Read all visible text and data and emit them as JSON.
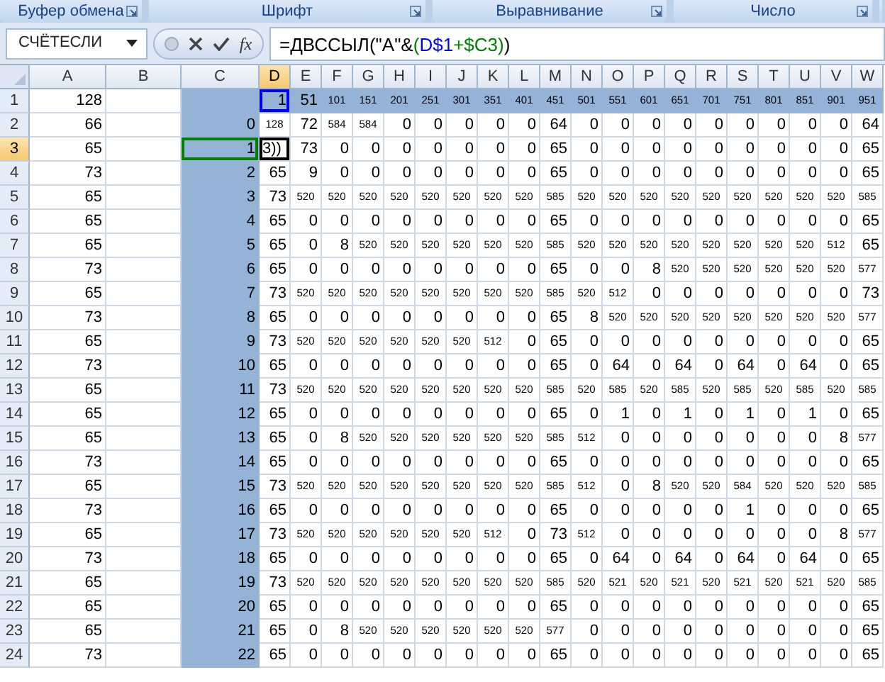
{
  "ribbon_groups": [
    {
      "label": "Буфер обмена"
    },
    {
      "label": "Шрифт"
    },
    {
      "label": "Выравнивание"
    },
    {
      "label": "Число"
    }
  ],
  "formula_bar": {
    "name_box": "СЧЁТЕСЛИ",
    "function_button": "fx",
    "formula": [
      {
        "text": "=ДВССЫЛ(\"A\"&",
        "color": "#000000"
      },
      {
        "text": "(",
        "color": "#008000"
      },
      {
        "text": "D$1",
        "color": "#0000ff"
      },
      {
        "text": "+$C3)",
        "color": "#008000"
      },
      {
        "text": ")",
        "color": "#000000"
      }
    ]
  },
  "columns": [
    {
      "label": "A",
      "selected": false,
      "shaded": false
    },
    {
      "label": "B",
      "selected": false,
      "shaded": false
    },
    {
      "label": "C",
      "selected": false,
      "shaded": true
    },
    {
      "label": "D",
      "selected": true,
      "shaded": false
    },
    {
      "label": "E",
      "selected": false,
      "shaded": false
    },
    {
      "label": "F",
      "selected": false,
      "shaded": false
    },
    {
      "label": "G",
      "selected": false,
      "shaded": false
    },
    {
      "label": "H",
      "selected": false,
      "shaded": false
    },
    {
      "label": "I",
      "selected": false,
      "shaded": false
    },
    {
      "label": "J",
      "selected": false,
      "shaded": false
    },
    {
      "label": "K",
      "selected": false,
      "shaded": false
    },
    {
      "label": "L",
      "selected": false,
      "shaded": false
    },
    {
      "label": "M",
      "selected": false,
      "shaded": false
    },
    {
      "label": "N",
      "selected": false,
      "shaded": false
    },
    {
      "label": "O",
      "selected": false,
      "shaded": false
    },
    {
      "label": "P",
      "selected": false,
      "shaded": false
    },
    {
      "label": "Q",
      "selected": false,
      "shaded": false
    },
    {
      "label": "R",
      "selected": false,
      "shaded": false
    },
    {
      "label": "S",
      "selected": false,
      "shaded": false
    },
    {
      "label": "T",
      "selected": false,
      "shaded": false
    },
    {
      "label": "U",
      "selected": false,
      "shaded": false
    },
    {
      "label": "V",
      "selected": false,
      "shaded": false
    },
    {
      "label": "W",
      "selected": false,
      "shaded": false
    }
  ],
  "rows": [
    {
      "header": "1",
      "selected": false,
      "shaded": true,
      "cells": [
        "128",
        null,
        null,
        {
          "text": "1",
          "color": "#0000ff"
        },
        "51",
        "101",
        "151",
        "201",
        "251",
        "301",
        "351",
        "401",
        "451",
        "501",
        "551",
        "601",
        "651",
        "701",
        "751",
        "801",
        "851",
        "901",
        "951"
      ]
    },
    {
      "header": "2",
      "selected": false,
      "cells": [
        "66",
        null,
        "0",
        "128",
        "72",
        "584",
        "584",
        "0",
        "0",
        "0",
        "0",
        "0",
        "64",
        "0",
        "0",
        "0",
        "0",
        "0",
        "0",
        "0",
        "0",
        "0",
        "64"
      ]
    },
    {
      "header": "3",
      "selected": true,
      "cells": [
        "65",
        null,
        {
          "text": "1",
          "color": "#008000"
        },
        {
          "text": "3))",
          "editing": true
        },
        "73",
        "0",
        "0",
        "0",
        "0",
        "0",
        "0",
        "0",
        "65",
        "0",
        "0",
        "0",
        "0",
        "0",
        "0",
        "0",
        "0",
        "0",
        "65"
      ]
    },
    {
      "header": "4",
      "selected": false,
      "cells": [
        "73",
        null,
        "2",
        "65",
        "9",
        "0",
        "0",
        "0",
        "0",
        "0",
        "0",
        "0",
        "65",
        "0",
        "0",
        "0",
        "0",
        "0",
        "0",
        "0",
        "0",
        "0",
        "65"
      ]
    },
    {
      "header": "5",
      "selected": false,
      "cells": [
        "65",
        null,
        "3",
        "73",
        "520",
        "520",
        "520",
        "520",
        "520",
        "520",
        "520",
        "520",
        "585",
        "520",
        "520",
        "520",
        "520",
        "520",
        "520",
        "520",
        "520",
        "520",
        "585"
      ]
    },
    {
      "header": "6",
      "selected": false,
      "cells": [
        "65",
        null,
        "4",
        "65",
        "0",
        "0",
        "0",
        "0",
        "0",
        "0",
        "0",
        "0",
        "65",
        "0",
        "0",
        "0",
        "0",
        "0",
        "0",
        "0",
        "0",
        "0",
        "65"
      ]
    },
    {
      "header": "7",
      "selected": false,
      "cells": [
        "65",
        null,
        "5",
        "65",
        "0",
        "8",
        "520",
        "520",
        "520",
        "520",
        "520",
        "520",
        "585",
        "520",
        "520",
        "520",
        "520",
        "520",
        "520",
        "520",
        "520",
        "512",
        "65"
      ]
    },
    {
      "header": "8",
      "selected": false,
      "cells": [
        "73",
        null,
        "6",
        "65",
        "0",
        "0",
        "0",
        "0",
        "0",
        "0",
        "0",
        "0",
        "65",
        "0",
        "0",
        "8",
        "520",
        "520",
        "520",
        "520",
        "520",
        "520",
        "577"
      ]
    },
    {
      "header": "9",
      "selected": false,
      "cells": [
        "65",
        null,
        "7",
        "73",
        "520",
        "520",
        "520",
        "520",
        "520",
        "520",
        "520",
        "520",
        "585",
        "520",
        "512",
        "0",
        "0",
        "0",
        "0",
        "0",
        "0",
        "0",
        "73"
      ]
    },
    {
      "header": "10",
      "selected": false,
      "cells": [
        "73",
        null,
        "8",
        "65",
        "0",
        "0",
        "0",
        "0",
        "0",
        "0",
        "0",
        "0",
        "65",
        "8",
        "520",
        "520",
        "520",
        "520",
        "520",
        "520",
        "520",
        "520",
        "577"
      ]
    },
    {
      "header": "11",
      "selected": false,
      "cells": [
        "65",
        null,
        "9",
        "73",
        "520",
        "520",
        "520",
        "520",
        "520",
        "520",
        "512",
        "0",
        "65",
        "0",
        "0",
        "0",
        "0",
        "0",
        "0",
        "0",
        "0",
        "0",
        "65"
      ]
    },
    {
      "header": "12",
      "selected": false,
      "cells": [
        "73",
        null,
        "10",
        "65",
        "0",
        "0",
        "0",
        "0",
        "0",
        "0",
        "0",
        "0",
        "65",
        "0",
        "64",
        "0",
        "64",
        "0",
        "64",
        "0",
        "64",
        "0",
        "65"
      ]
    },
    {
      "header": "13",
      "selected": false,
      "cells": [
        "65",
        null,
        "11",
        "73",
        "520",
        "520",
        "520",
        "520",
        "520",
        "520",
        "520",
        "520",
        "585",
        "520",
        "585",
        "520",
        "585",
        "520",
        "585",
        "520",
        "585",
        "520",
        "585"
      ]
    },
    {
      "header": "14",
      "selected": false,
      "cells": [
        "65",
        null,
        "12",
        "65",
        "0",
        "0",
        "0",
        "0",
        "0",
        "0",
        "0",
        "0",
        "65",
        "0",
        "1",
        "0",
        "1",
        "0",
        "1",
        "0",
        "1",
        "0",
        "65"
      ]
    },
    {
      "header": "15",
      "selected": false,
      "cells": [
        "65",
        null,
        "13",
        "65",
        "0",
        "8",
        "520",
        "520",
        "520",
        "520",
        "520",
        "520",
        "585",
        "512",
        "0",
        "0",
        "0",
        "0",
        "0",
        "0",
        "0",
        "8",
        "577"
      ]
    },
    {
      "header": "16",
      "selected": false,
      "cells": [
        "73",
        null,
        "14",
        "65",
        "0",
        "0",
        "0",
        "0",
        "0",
        "0",
        "0",
        "0",
        "65",
        "0",
        "0",
        "0",
        "0",
        "0",
        "0",
        "0",
        "0",
        "0",
        "65"
      ]
    },
    {
      "header": "17",
      "selected": false,
      "cells": [
        "65",
        null,
        "15",
        "73",
        "520",
        "520",
        "520",
        "520",
        "520",
        "520",
        "520",
        "520",
        "585",
        "512",
        "0",
        "8",
        "520",
        "520",
        "584",
        "520",
        "520",
        "520",
        "585"
      ]
    },
    {
      "header": "18",
      "selected": false,
      "cells": [
        "73",
        null,
        "16",
        "65",
        "0",
        "0",
        "0",
        "0",
        "0",
        "0",
        "0",
        "0",
        "65",
        "0",
        "0",
        "0",
        "0",
        "0",
        "1",
        "0",
        "0",
        "0",
        "65"
      ]
    },
    {
      "header": "19",
      "selected": false,
      "cells": [
        "65",
        null,
        "17",
        "73",
        "520",
        "520",
        "520",
        "520",
        "520",
        "520",
        "512",
        "0",
        "73",
        "512",
        "0",
        "0",
        "0",
        "0",
        "0",
        "0",
        "0",
        "8",
        "577"
      ]
    },
    {
      "header": "20",
      "selected": false,
      "cells": [
        "73",
        null,
        "18",
        "65",
        "0",
        "0",
        "0",
        "0",
        "0",
        "0",
        "0",
        "0",
        "65",
        "0",
        "64",
        "0",
        "64",
        "0",
        "64",
        "0",
        "64",
        "0",
        "65"
      ]
    },
    {
      "header": "21",
      "selected": false,
      "cells": [
        "65",
        null,
        "19",
        "73",
        "520",
        "520",
        "520",
        "520",
        "520",
        "520",
        "520",
        "520",
        "585",
        "520",
        "521",
        "520",
        "521",
        "520",
        "521",
        "520",
        "521",
        "520",
        "585"
      ]
    },
    {
      "header": "22",
      "selected": false,
      "cells": [
        "65",
        null,
        "20",
        "65",
        "0",
        "0",
        "0",
        "0",
        "0",
        "0",
        "0",
        "0",
        "65",
        "0",
        "0",
        "0",
        "0",
        "0",
        "0",
        "0",
        "0",
        "0",
        "65"
      ]
    },
    {
      "header": "23",
      "selected": false,
      "cells": [
        "65",
        null,
        "21",
        "65",
        "0",
        "8",
        "520",
        "520",
        "520",
        "520",
        "520",
        "520",
        "577",
        "0",
        "0",
        "0",
        "0",
        "0",
        "0",
        "0",
        "0",
        "0",
        "65"
      ]
    },
    {
      "header": "24",
      "selected": false,
      "cells": [
        "73",
        null,
        "22",
        "65",
        "0",
        "0",
        "0",
        "0",
        "0",
        "0",
        "0",
        "0",
        "65",
        "0",
        "0",
        "0",
        "0",
        "0",
        "0",
        "0",
        "0",
        "0",
        "65"
      ]
    }
  ]
}
